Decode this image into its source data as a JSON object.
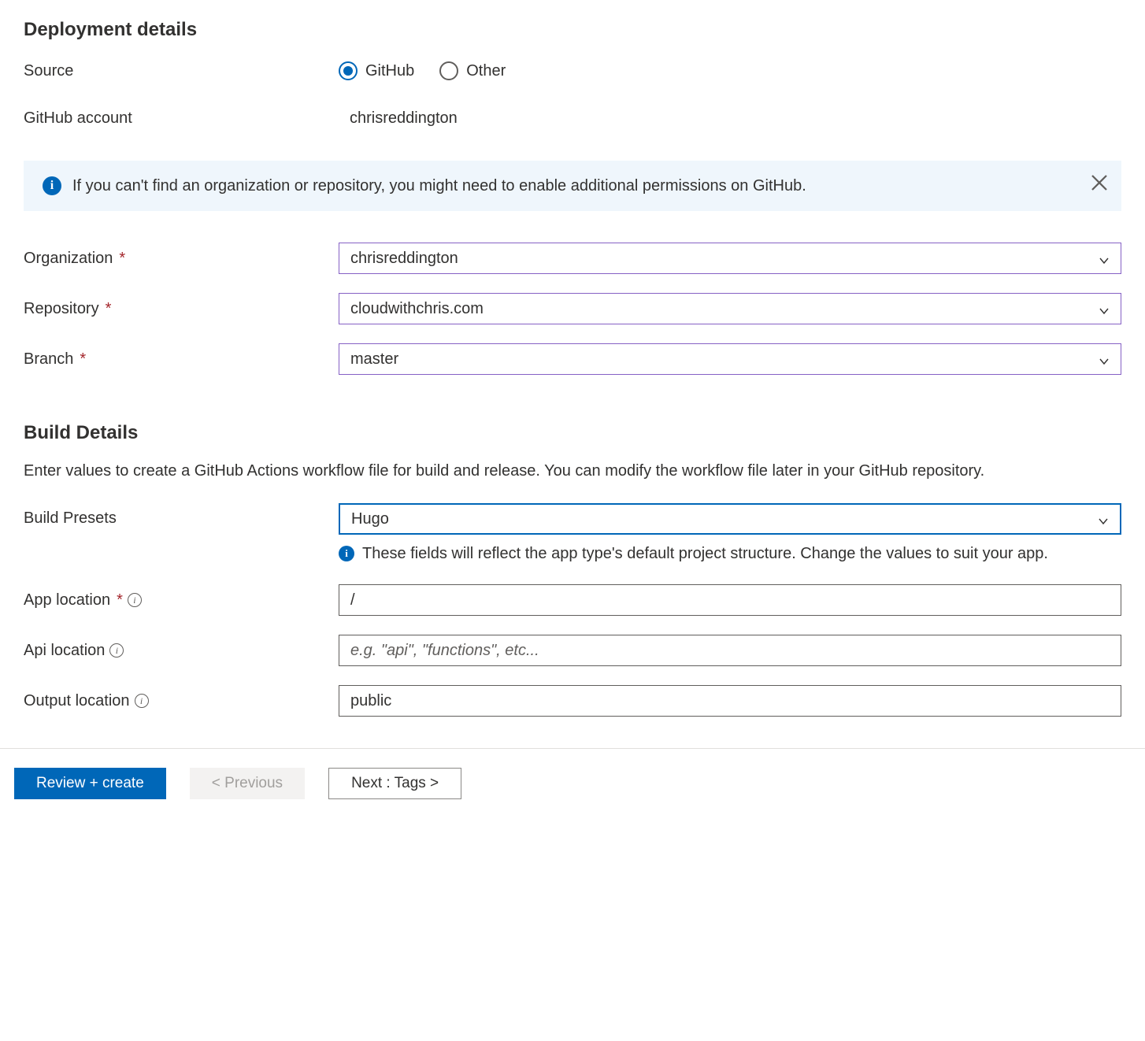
{
  "sections": {
    "deployment": {
      "title": "Deployment details",
      "source_label": "Source",
      "source_options": {
        "github": "GitHub",
        "other": "Other"
      },
      "source_selected": "github",
      "github_account_label": "GitHub account",
      "github_account_value": "chrisreddington",
      "info_banner": "If you can't find an organization or repository, you might need to enable additional permissions on GitHub.",
      "organization_label": "Organization",
      "organization_value": "chrisreddington",
      "repository_label": "Repository",
      "repository_value": "cloudwithchris.com",
      "branch_label": "Branch",
      "branch_value": "master"
    },
    "build": {
      "title": "Build Details",
      "description": "Enter values to create a GitHub Actions workflow file for build and release. You can modify the workflow file later in your GitHub repository.",
      "presets_label": "Build Presets",
      "presets_value": "Hugo",
      "presets_note": "These fields will reflect the app type's default project structure. Change the values to suit your app.",
      "app_location_label": "App location",
      "app_location_value": "/",
      "api_location_label": "Api location",
      "api_location_placeholder": "e.g. \"api\", \"functions\", etc...",
      "output_location_label": "Output location",
      "output_location_value": "public"
    }
  },
  "footer": {
    "review": "Review + create",
    "previous": "< Previous",
    "next": "Next : Tags >"
  }
}
